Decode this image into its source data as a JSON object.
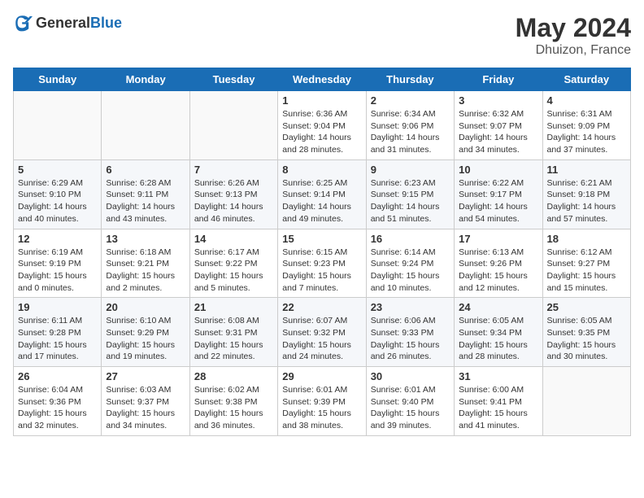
{
  "header": {
    "logo_general": "General",
    "logo_blue": "Blue",
    "title": "May 2024",
    "subtitle": "Dhuizon, France"
  },
  "days_of_week": [
    "Sunday",
    "Monday",
    "Tuesday",
    "Wednesday",
    "Thursday",
    "Friday",
    "Saturday"
  ],
  "weeks": [
    {
      "days": [
        {
          "date": "",
          "info": ""
        },
        {
          "date": "",
          "info": ""
        },
        {
          "date": "",
          "info": ""
        },
        {
          "date": "1",
          "info": "Sunrise: 6:36 AM\nSunset: 9:04 PM\nDaylight: 14 hours and 28 minutes."
        },
        {
          "date": "2",
          "info": "Sunrise: 6:34 AM\nSunset: 9:06 PM\nDaylight: 14 hours and 31 minutes."
        },
        {
          "date": "3",
          "info": "Sunrise: 6:32 AM\nSunset: 9:07 PM\nDaylight: 14 hours and 34 minutes."
        },
        {
          "date": "4",
          "info": "Sunrise: 6:31 AM\nSunset: 9:09 PM\nDaylight: 14 hours and 37 minutes."
        }
      ]
    },
    {
      "days": [
        {
          "date": "5",
          "info": "Sunrise: 6:29 AM\nSunset: 9:10 PM\nDaylight: 14 hours and 40 minutes."
        },
        {
          "date": "6",
          "info": "Sunrise: 6:28 AM\nSunset: 9:11 PM\nDaylight: 14 hours and 43 minutes."
        },
        {
          "date": "7",
          "info": "Sunrise: 6:26 AM\nSunset: 9:13 PM\nDaylight: 14 hours and 46 minutes."
        },
        {
          "date": "8",
          "info": "Sunrise: 6:25 AM\nSunset: 9:14 PM\nDaylight: 14 hours and 49 minutes."
        },
        {
          "date": "9",
          "info": "Sunrise: 6:23 AM\nSunset: 9:15 PM\nDaylight: 14 hours and 51 minutes."
        },
        {
          "date": "10",
          "info": "Sunrise: 6:22 AM\nSunset: 9:17 PM\nDaylight: 14 hours and 54 minutes."
        },
        {
          "date": "11",
          "info": "Sunrise: 6:21 AM\nSunset: 9:18 PM\nDaylight: 14 hours and 57 minutes."
        }
      ]
    },
    {
      "days": [
        {
          "date": "12",
          "info": "Sunrise: 6:19 AM\nSunset: 9:19 PM\nDaylight: 15 hours and 0 minutes."
        },
        {
          "date": "13",
          "info": "Sunrise: 6:18 AM\nSunset: 9:21 PM\nDaylight: 15 hours and 2 minutes."
        },
        {
          "date": "14",
          "info": "Sunrise: 6:17 AM\nSunset: 9:22 PM\nDaylight: 15 hours and 5 minutes."
        },
        {
          "date": "15",
          "info": "Sunrise: 6:15 AM\nSunset: 9:23 PM\nDaylight: 15 hours and 7 minutes."
        },
        {
          "date": "16",
          "info": "Sunrise: 6:14 AM\nSunset: 9:24 PM\nDaylight: 15 hours and 10 minutes."
        },
        {
          "date": "17",
          "info": "Sunrise: 6:13 AM\nSunset: 9:26 PM\nDaylight: 15 hours and 12 minutes."
        },
        {
          "date": "18",
          "info": "Sunrise: 6:12 AM\nSunset: 9:27 PM\nDaylight: 15 hours and 15 minutes."
        }
      ]
    },
    {
      "days": [
        {
          "date": "19",
          "info": "Sunrise: 6:11 AM\nSunset: 9:28 PM\nDaylight: 15 hours and 17 minutes."
        },
        {
          "date": "20",
          "info": "Sunrise: 6:10 AM\nSunset: 9:29 PM\nDaylight: 15 hours and 19 minutes."
        },
        {
          "date": "21",
          "info": "Sunrise: 6:08 AM\nSunset: 9:31 PM\nDaylight: 15 hours and 22 minutes."
        },
        {
          "date": "22",
          "info": "Sunrise: 6:07 AM\nSunset: 9:32 PM\nDaylight: 15 hours and 24 minutes."
        },
        {
          "date": "23",
          "info": "Sunrise: 6:06 AM\nSunset: 9:33 PM\nDaylight: 15 hours and 26 minutes."
        },
        {
          "date": "24",
          "info": "Sunrise: 6:05 AM\nSunset: 9:34 PM\nDaylight: 15 hours and 28 minutes."
        },
        {
          "date": "25",
          "info": "Sunrise: 6:05 AM\nSunset: 9:35 PM\nDaylight: 15 hours and 30 minutes."
        }
      ]
    },
    {
      "days": [
        {
          "date": "26",
          "info": "Sunrise: 6:04 AM\nSunset: 9:36 PM\nDaylight: 15 hours and 32 minutes."
        },
        {
          "date": "27",
          "info": "Sunrise: 6:03 AM\nSunset: 9:37 PM\nDaylight: 15 hours and 34 minutes."
        },
        {
          "date": "28",
          "info": "Sunrise: 6:02 AM\nSunset: 9:38 PM\nDaylight: 15 hours and 36 minutes."
        },
        {
          "date": "29",
          "info": "Sunrise: 6:01 AM\nSunset: 9:39 PM\nDaylight: 15 hours and 38 minutes."
        },
        {
          "date": "30",
          "info": "Sunrise: 6:01 AM\nSunset: 9:40 PM\nDaylight: 15 hours and 39 minutes."
        },
        {
          "date": "31",
          "info": "Sunrise: 6:00 AM\nSunset: 9:41 PM\nDaylight: 15 hours and 41 minutes."
        },
        {
          "date": "",
          "info": ""
        }
      ]
    }
  ]
}
